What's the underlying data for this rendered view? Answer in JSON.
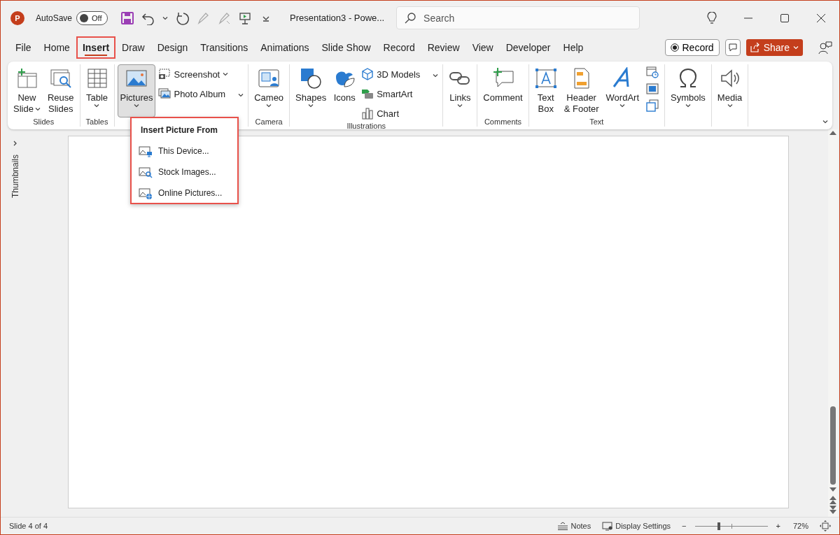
{
  "title_bar": {
    "logo": "P",
    "autosave_label": "AutoSave",
    "autosave_toggle": {
      "on": false,
      "label": "Off"
    },
    "document_title": "Presentation3  -  Powe...",
    "search": {
      "placeholder": "Search"
    }
  },
  "tabs": [
    {
      "label": "File",
      "selected": false,
      "outlined": false
    },
    {
      "label": "Home",
      "selected": false,
      "outlined": false
    },
    {
      "label": "Insert",
      "selected": true,
      "outlined": true
    },
    {
      "label": "Draw",
      "selected": false,
      "outlined": false
    },
    {
      "label": "Design",
      "selected": false,
      "outlined": false
    },
    {
      "label": "Transitions",
      "selected": false,
      "outlined": false
    },
    {
      "label": "Animations",
      "selected": false,
      "outlined": false
    },
    {
      "label": "Slide Show",
      "selected": false,
      "outlined": false
    },
    {
      "label": "Record",
      "selected": false,
      "outlined": false
    },
    {
      "label": "Review",
      "selected": false,
      "outlined": false
    },
    {
      "label": "View",
      "selected": false,
      "outlined": false
    },
    {
      "label": "Developer",
      "selected": false,
      "outlined": false
    },
    {
      "label": "Help",
      "selected": false,
      "outlined": false
    }
  ],
  "record_button": "Record",
  "share_button": "Share",
  "ribbon_groups": [
    {
      "name": "Slides",
      "items": [
        {
          "kind": "large",
          "lines": [
            "New",
            "Slide"
          ],
          "dropdown": true,
          "pressed": false
        },
        {
          "kind": "large",
          "lines": [
            "Reuse",
            "Slides"
          ],
          "dropdown": false,
          "pressed": false
        }
      ]
    },
    {
      "name": "Tables",
      "items": [
        {
          "kind": "large",
          "lines": [
            "Table"
          ],
          "dropdown": true,
          "pressed": false
        }
      ]
    },
    {
      "items": [
        {
          "kind": "large",
          "lines": [
            "Pictures"
          ],
          "dropdown": true,
          "pressed": true
        },
        {
          "kind": "stack",
          "buttons": [
            {
              "label": "Screenshot",
              "kind": "menu"
            },
            {
              "label": "Photo Album",
              "kind": "split"
            }
          ]
        }
      ]
    },
    {
      "name": "Camera",
      "items": [
        {
          "kind": "large",
          "lines": [
            "Cameo"
          ],
          "dropdown": true,
          "pressed": false
        }
      ]
    },
    {
      "name": "Illustrations",
      "items": [
        {
          "kind": "large",
          "lines": [
            "Shapes"
          ],
          "dropdown": true,
          "pressed": false
        },
        {
          "kind": "large",
          "lines": [
            "Icons"
          ],
          "dropdown": false,
          "pressed": false
        },
        {
          "kind": "stack",
          "buttons": [
            {
              "label": "3D Models",
              "kind": "split"
            },
            {
              "label": "SmartArt",
              "kind": "plain"
            },
            {
              "label": "Chart",
              "kind": "plain"
            }
          ]
        }
      ]
    },
    {
      "items": [
        {
          "kind": "large",
          "lines": [
            "Links"
          ],
          "dropdown": true,
          "pressed": false
        }
      ]
    },
    {
      "name": "Comments",
      "items": [
        {
          "kind": "large",
          "lines": [
            "Comment"
          ],
          "dropdown": false,
          "pressed": false
        }
      ]
    },
    {
      "name": "Text",
      "items": [
        {
          "kind": "large",
          "lines": [
            "Text",
            "Box"
          ],
          "dropdown": false,
          "pressed": false
        },
        {
          "kind": "large",
          "lines": [
            "Header",
            "& Footer"
          ],
          "dropdown": false,
          "pressed": false
        },
        {
          "kind": "large",
          "lines": [
            "WordArt"
          ],
          "dropdown": true,
          "pressed": false
        },
        {
          "kind": "icon_stack"
        }
      ]
    },
    {
      "items": [
        {
          "kind": "large",
          "lines": [
            "Symbols"
          ],
          "dropdown": true,
          "pressed": false
        }
      ]
    },
    {
      "items": [
        {
          "kind": "large",
          "lines": [
            "Media"
          ],
          "dropdown": true,
          "pressed": false
        }
      ]
    }
  ],
  "picture_menu": {
    "outlined": true,
    "title": "Insert Picture From",
    "items": [
      {
        "label": "This Device..."
      },
      {
        "label": "Stock Images..."
      },
      {
        "label": "Online Pictures..."
      }
    ]
  },
  "thumbnails_pane": {
    "label": "Thumbnails"
  },
  "status_bar": {
    "slide_info": "Slide 4 of 4",
    "notes": "Notes",
    "display_settings": "Display Settings",
    "zoom_out": "−",
    "zoom_in": "+",
    "zoom": {
      "level": 0.33
    },
    "zoom_percent": "72%"
  }
}
